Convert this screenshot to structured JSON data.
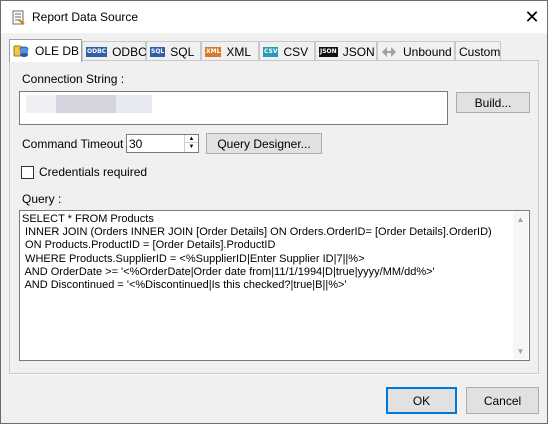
{
  "window": {
    "title": "Report Data Source",
    "close_glyph": "✕"
  },
  "tabs": [
    {
      "label": "OLE DB",
      "icon": "ole-db-icon",
      "active": true
    },
    {
      "label": "ODBC",
      "icon": "odbc-icon",
      "icon_text": "ODBC"
    },
    {
      "label": "SQL",
      "icon": "sql-icon",
      "icon_text": "SQL"
    },
    {
      "label": "XML",
      "icon": "xml-icon",
      "icon_text": "XML"
    },
    {
      "label": "CSV",
      "icon": "csv-icon",
      "icon_text": "CSV"
    },
    {
      "label": "JSON",
      "icon": "json-icon",
      "icon_text": "JSON"
    },
    {
      "label": "Unbound",
      "icon": "unbound-icon"
    },
    {
      "label": "Custom"
    }
  ],
  "connection": {
    "label": "Connection String :",
    "build_label": "Build..."
  },
  "timeout": {
    "label": "Command Timeout :",
    "value": "30",
    "query_designer_label": "Query Designer..."
  },
  "credentials": {
    "label": "Credentials required",
    "checked": false
  },
  "query": {
    "label": "Query :",
    "lines": [
      "SELECT * FROM Products",
      " INNER JOIN (Orders INNER JOIN [Order Details] ON Orders.OrderID= [Order Details].OrderID)",
      " ON Products.ProductID = [Order Details].ProductID",
      " WHERE Products.SupplierID = <%SupplierID|Enter Supplier ID|7||%>",
      " AND OrderDate >= '<%OrderDate|Order date from|11/1/1994|D|true|yyyy/MM/dd%>'",
      " AND Discontinued = '<%Discontinued|Is this checked?|true|B||%>'"
    ]
  },
  "footer": {
    "ok_label": "OK",
    "cancel_label": "Cancel"
  },
  "colors": {
    "accent": "#0078d7",
    "window_bg": "#f0f0f0"
  }
}
